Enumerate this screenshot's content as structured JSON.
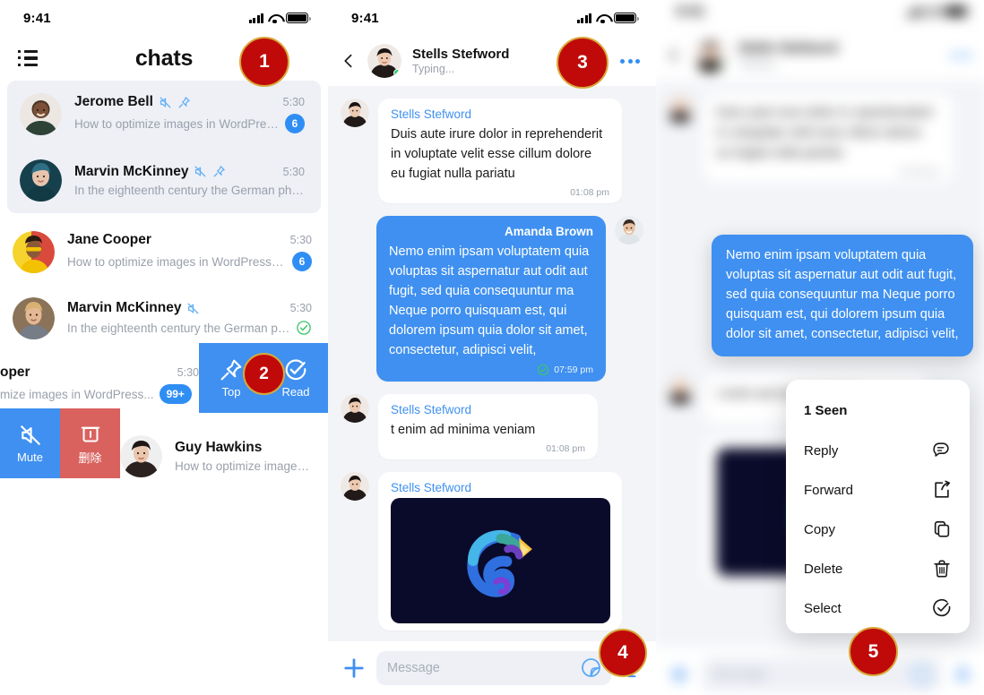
{
  "status_bar": {
    "time": "9:41",
    "signal_icon": "cellular-signal-icon",
    "wifi_icon": "wifi-icon",
    "battery_icon": "battery-icon"
  },
  "chat_list_panel": {
    "menu_icon": "list-menu-icon",
    "title": "chats",
    "rows": [
      {
        "name": "Jerome Bell",
        "preview": "How to optimize images in WordPress for...",
        "time": "5:30",
        "badge": "6",
        "muted": true,
        "pinned": true,
        "read_check": false
      },
      {
        "name": "Marvin McKinney",
        "preview": "In the eighteenth century the German philosoph...",
        "time": "5:30",
        "badge": "",
        "muted": true,
        "pinned": true,
        "read_check": false
      },
      {
        "name": "Jane Cooper",
        "preview": "How to optimize images in WordPress for...",
        "time": "5:30",
        "badge": "6",
        "muted": false,
        "pinned": false,
        "read_check": false
      },
      {
        "name": "Marvin McKinney",
        "preview": "In the eighteenth century the German philos...",
        "time": "5:30",
        "badge": "",
        "muted": true,
        "pinned": false,
        "read_check": true
      },
      {
        "name": "oper",
        "preview": "mize images in WordPress...",
        "time": "5:30",
        "badge": "99+",
        "muted": false,
        "pinned": false,
        "read_check": false
      },
      {
        "name": "Guy Hawkins",
        "preview": "How to optimize images in W",
        "time": "",
        "badge": "",
        "muted": false,
        "pinned": false,
        "read_check": false
      }
    ],
    "swipe_right_actions": [
      {
        "label": "Top",
        "icon": "pin-icon",
        "color": "#3f90f0"
      },
      {
        "label": "Read",
        "icon": "check-circle-icon",
        "color": "#3f90f0"
      }
    ],
    "swipe_left_actions": [
      {
        "label": "Mute",
        "icon": "mute-icon",
        "color": "#3f90f0"
      },
      {
        "label": "删除",
        "icon": "trash-icon",
        "color": "#d9625f"
      }
    ]
  },
  "chat_panel": {
    "back_icon": "back-chevron-icon",
    "contact_name": "Stells Stefword",
    "contact_status": "Typing...",
    "more_icon": "more-options-icon",
    "online": true,
    "messages": [
      {
        "sender": "Stells Stefword",
        "text": "Duis aute irure dolor in reprehenderit in voluptate velit esse cillum dolore eu fugiat nulla pariatu",
        "time": "01:08 pm",
        "outgoing": false,
        "read": false
      },
      {
        "sender": "Amanda Brown",
        "text": "Nemo enim ipsam voluptatem quia voluptas sit aspernatur aut odit aut fugit, sed quia consequuntur ma Neque porro quisquam est, qui dolorem ipsum quia dolor sit amet, consectetur, adipisci velit,",
        "time": "07:59 pm",
        "outgoing": true,
        "read": true
      },
      {
        "sender": "Stells Stefword",
        "text": "t enim ad minima veniam",
        "time": "01:08 pm",
        "outgoing": false,
        "read": false
      },
      {
        "sender": "Stells Stefword",
        "text": "",
        "time": "",
        "outgoing": false,
        "read": false,
        "image": "chameleon-logo-image"
      }
    ],
    "input": {
      "placeholder": "Message",
      "value": "",
      "add_icon": "plus-icon",
      "sticker_icon": "sticker-icon",
      "mic_icon": "microphone-icon"
    }
  },
  "menu_panel": {
    "highlighted_message": "Nemo enim ipsam voluptatem quia voluptas sit aspernatur aut odit aut fugit, sed quia consequuntur ma Neque porro quisquam est, qui dolorem ipsum quia dolor sit amet, consectetur, adipisci velit,",
    "context_menu": {
      "header": "1 Seen",
      "items": [
        {
          "label": "Reply",
          "icon": "reply-icon"
        },
        {
          "label": "Forward",
          "icon": "forward-icon"
        },
        {
          "label": "Copy",
          "icon": "copy-icon"
        },
        {
          "label": "Delete",
          "icon": "trash-icon"
        },
        {
          "label": "Select",
          "icon": "check-circle-icon"
        }
      ]
    }
  },
  "markers": {
    "m1": "1",
    "m2": "2",
    "m3": "3",
    "m4": "4",
    "m5": "5"
  },
  "colors": {
    "accent_blue": "#3f90f0",
    "badge_blue": "#2f8ef4",
    "danger_red": "#d9625f",
    "marker_red": "#c00a0a",
    "marker_ring": "#d8a93a",
    "chat_bg": "#f2f4f8",
    "highlight_row": "#eef0f6",
    "online_green": "#25d366"
  }
}
